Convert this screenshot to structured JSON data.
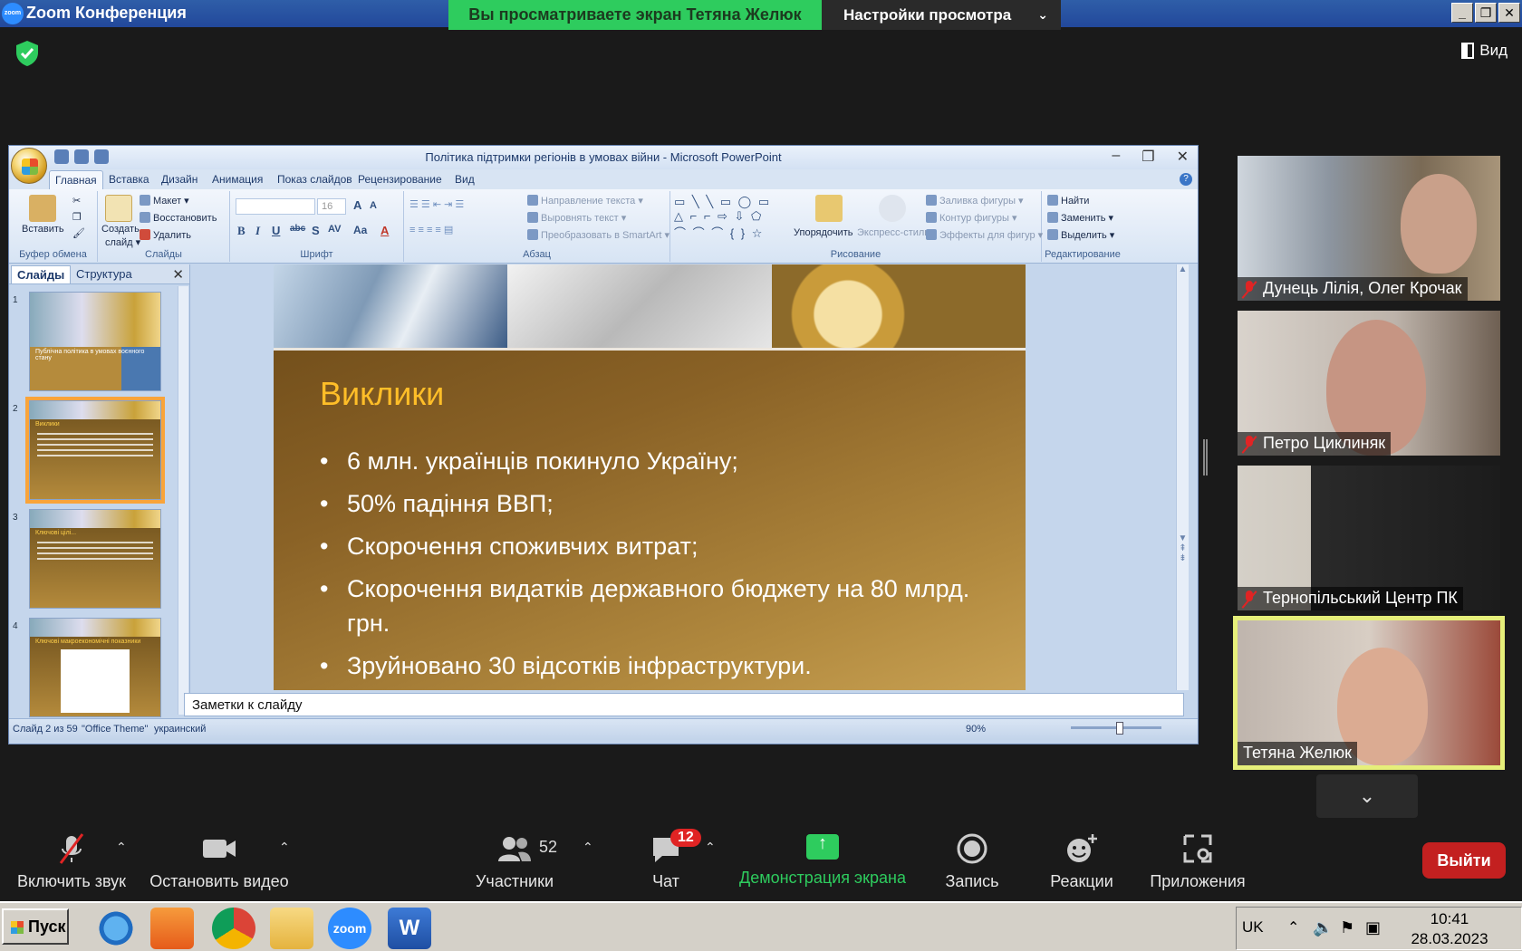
{
  "zoom": {
    "title": "Zoom Конференция",
    "logo_text": "zoom",
    "share_banner": "Вы просматриваете экран Тетяна Желюк",
    "view_settings": "Настройки просмотра",
    "view_button": "Вид",
    "leave_button": "Выйти"
  },
  "powerpoint": {
    "window_title": "Політика підтримки регіонів в умовах війни - Microsoft PowerPoint",
    "tabs": [
      "Главная",
      "Вставка",
      "Дизайн",
      "Анимация",
      "Показ слайдов",
      "Рецензирование",
      "Вид"
    ],
    "groups": {
      "clipboard": {
        "label": "Буфер обмена",
        "paste": "Вставить"
      },
      "slides": {
        "label": "Слайды",
        "create": "Создать",
        "create2": "слайд ▾",
        "layout": "Макет ▾",
        "reset": "Восстановить",
        "delete": "Удалить"
      },
      "font": {
        "label": "Шрифт",
        "size": "16"
      },
      "paragraph": {
        "label": "Абзац",
        "text_dir": "Направление текста ▾",
        "align_text": "Выровнять текст ▾",
        "smartart": "Преобразовать в SmartArt ▾"
      },
      "drawing": {
        "label": "Рисование",
        "arrange": "Упорядочить",
        "quick_styles": "Экспресс-стили",
        "fill": "Заливка фигуры ▾",
        "outline": "Контур фигуры ▾",
        "effects": "Эффекты для фигур ▾"
      },
      "editing": {
        "label": "Редактирование",
        "find": "Найти",
        "replace": "Заменить ▾",
        "select": "Выделить ▾"
      }
    },
    "pane_tabs": {
      "slides": "Слайды",
      "outline": "Структура"
    },
    "thumbnails": [
      {
        "num": "1",
        "title": "Публічна політика в умовах воєнного стану"
      },
      {
        "num": "2",
        "title": "Виклики"
      },
      {
        "num": "3",
        "title": "Ключові цілі..."
      },
      {
        "num": "4",
        "title": "Ключові макроекономічні показники"
      }
    ],
    "slide": {
      "title": "Виклики",
      "bullets": [
        "6 млн. українців покинуло Україну;",
        "50% падіння ВВП;",
        "Скорочення споживчих витрат;",
        "Скорочення видатків державного бюджету на 80 млрд. грн.",
        "Зруйновано 30 відсотків інфраструктури."
      ]
    },
    "notes_placeholder": "Заметки к слайду",
    "status": {
      "slide": "Слайд 2 из 59",
      "theme": "\"Office Theme\"",
      "lang": "украинский",
      "zoom": "90%"
    }
  },
  "participants": [
    {
      "name": "Дунець Лілія, Олег Крочак",
      "muted": true
    },
    {
      "name": "Петро Циклиняк",
      "muted": true
    },
    {
      "name": "Тернопільський Центр ПК",
      "muted": true
    },
    {
      "name": "Тетяна Желюк",
      "muted": false
    }
  ],
  "toolbar": {
    "mic": "Включить звук",
    "video": "Остановить видео",
    "participants": "Участники",
    "participants_count": "52",
    "chat": "Чат",
    "chat_badge": "12",
    "share": "Демонстрация экрана",
    "record": "Запись",
    "reactions": "Реакции",
    "apps": "Приложения"
  },
  "taskbar": {
    "start": "Пуск",
    "lang": "UK",
    "time": "10:41",
    "date": "28.03.2023"
  },
  "colors": {
    "zoom_green": "#2ecc5e",
    "slide_title": "#ffbe28",
    "leave_red": "#c32020"
  }
}
